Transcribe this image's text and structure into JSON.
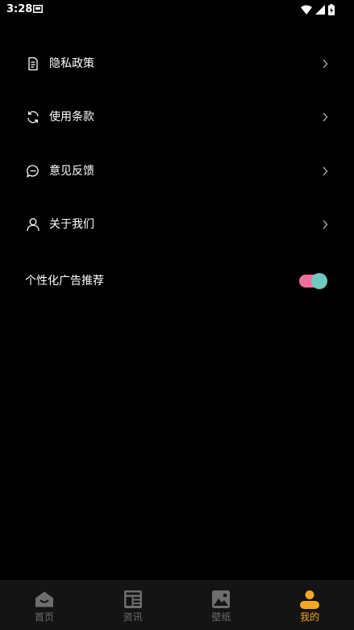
{
  "status_bar": {
    "time": "3:28"
  },
  "menu": [
    {
      "label": "隐私政策",
      "icon": "document-icon"
    },
    {
      "label": "使用条款",
      "icon": "refresh-icon"
    },
    {
      "label": "意见反馈",
      "icon": "chat-bubble-icon"
    },
    {
      "label": "关于我们",
      "icon": "person-icon"
    }
  ],
  "ad_setting": {
    "label": "个性化广告推荐",
    "enabled": true
  },
  "tabs": [
    {
      "label": "首页",
      "icon": "home-icon",
      "active": false
    },
    {
      "label": "资讯",
      "icon": "news-icon",
      "active": false
    },
    {
      "label": "壁纸",
      "icon": "image-icon",
      "active": false
    },
    {
      "label": "我的",
      "icon": "profile-icon",
      "active": true
    }
  ],
  "colors": {
    "background": "#000000",
    "tab_bar": "#141414",
    "active_tab": "#f5a623",
    "inactive_tab": "#6e6e6e",
    "toggle_track": "#ef6f9b",
    "toggle_knob": "#6ec9bf"
  }
}
